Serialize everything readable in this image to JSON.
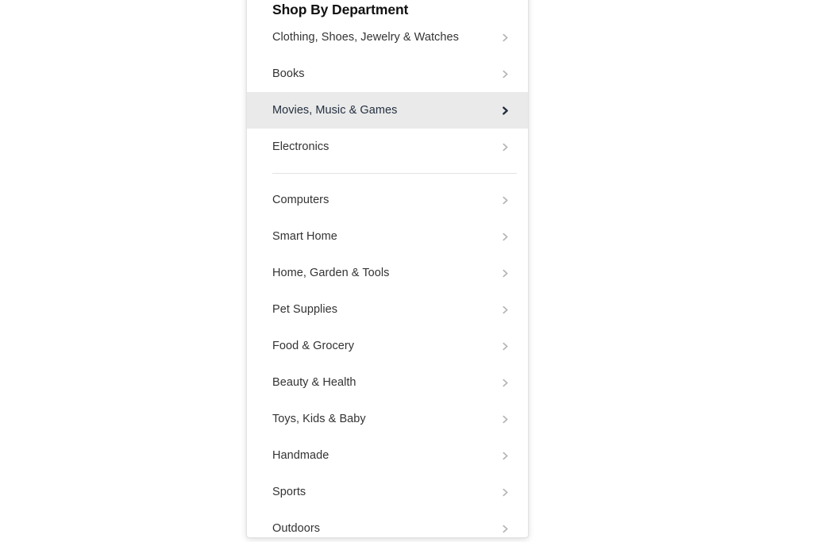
{
  "panel": {
    "title": "Shop By Department",
    "chevron_icon": "chevron-right-icon",
    "groups": [
      {
        "items": [
          {
            "label": "Clothing, Shoes, Jewelry & Watches",
            "selected": false
          },
          {
            "label": "Books",
            "selected": false
          },
          {
            "label": "Movies, Music & Games",
            "selected": true
          },
          {
            "label": "Electronics",
            "selected": false
          }
        ]
      },
      {
        "items": [
          {
            "label": "Computers",
            "selected": false
          },
          {
            "label": "Smart Home",
            "selected": false
          },
          {
            "label": "Home, Garden & Tools",
            "selected": false
          },
          {
            "label": "Pet Supplies",
            "selected": false
          },
          {
            "label": "Food & Grocery",
            "selected": false
          },
          {
            "label": "Beauty & Health",
            "selected": false
          },
          {
            "label": "Toys, Kids & Baby",
            "selected": false
          },
          {
            "label": "Handmade",
            "selected": false
          },
          {
            "label": "Sports",
            "selected": false
          },
          {
            "label": "Outdoors",
            "selected": false
          }
        ]
      }
    ]
  },
  "colors": {
    "page_background": "#ffffff",
    "panel_background": "#ffffff",
    "panel_border": "#e3e3e3",
    "selected_row_background": "#eaeaea",
    "title_text": "#111111",
    "item_text": "#333333",
    "chevron": "#b4b4b4",
    "chevron_selected": "#232f3e",
    "divider": "#e3e3e3"
  }
}
